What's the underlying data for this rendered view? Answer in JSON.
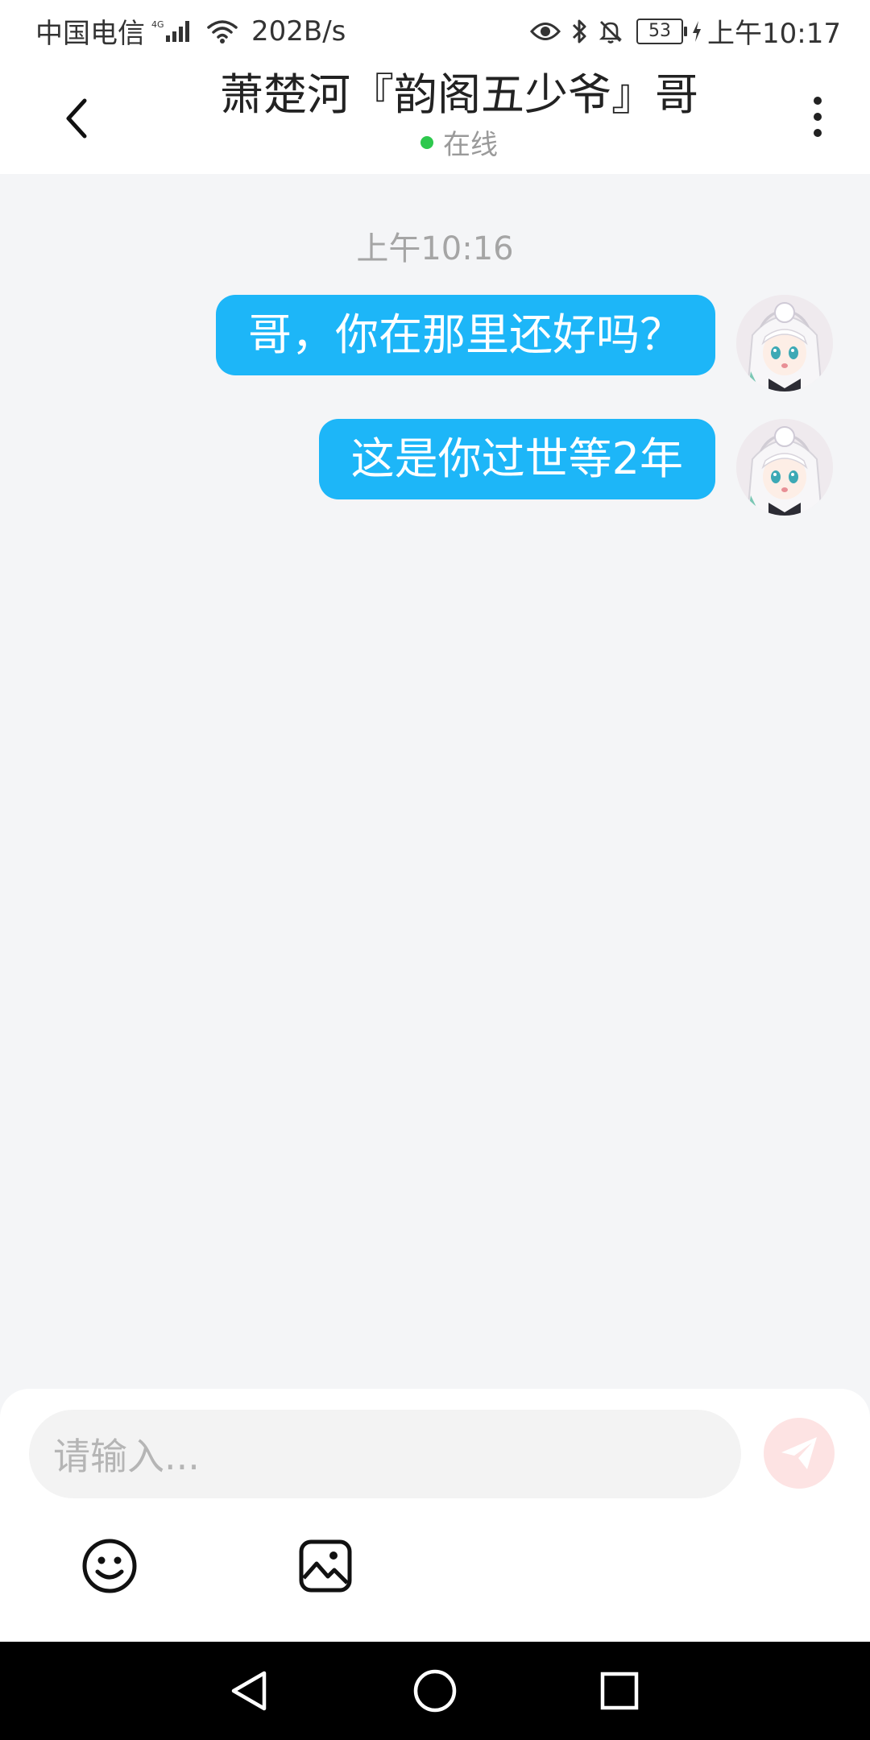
{
  "status_bar": {
    "carrier": "中国电信",
    "network": "4G",
    "speed": "202B/s",
    "battery": "53",
    "time": "上午10:17"
  },
  "header": {
    "title": "萧楚河『韵阁五少爷』哥",
    "status": "在线",
    "status_color": "#2dc84d"
  },
  "chat": {
    "timestamp": "上午10:16",
    "messages": [
      {
        "text": "哥，你在那里还好吗？",
        "sender": "me"
      },
      {
        "text": "这是你过世等2年",
        "sender": "me"
      }
    ],
    "bubble_color": "#1db6f8"
  },
  "composer": {
    "placeholder": "请输入...",
    "send_icon": "paper-plane-icon",
    "tools": [
      "emoji-icon",
      "image-icon"
    ]
  },
  "nav": {
    "buttons": [
      "back-triangle-icon",
      "home-circle-icon",
      "recents-square-icon"
    ]
  }
}
